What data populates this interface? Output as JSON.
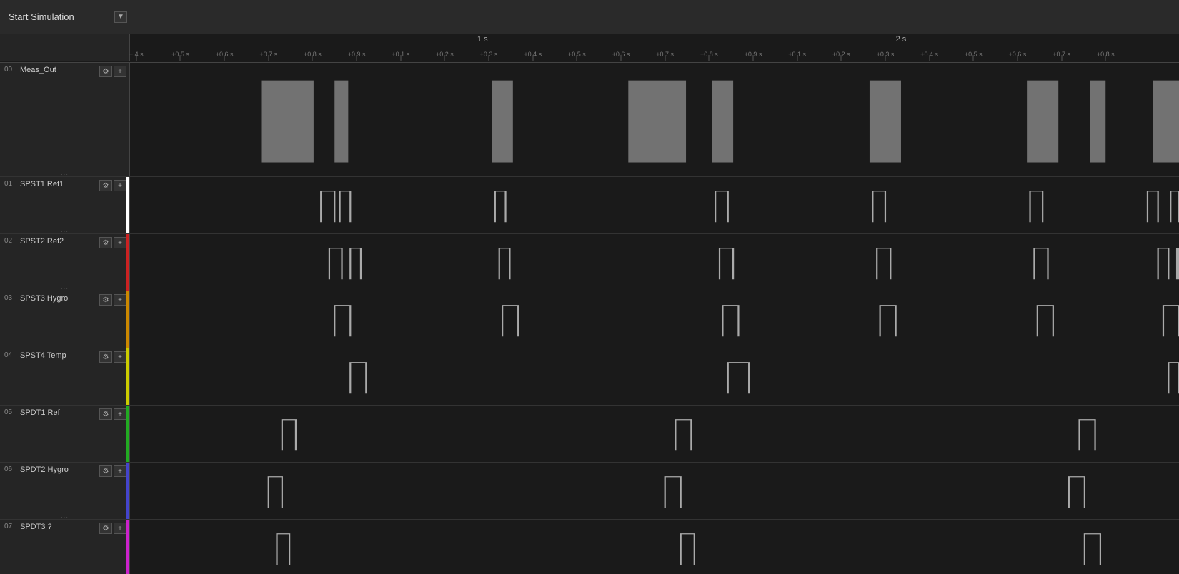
{
  "header": {
    "start_simulation_label": "Start Simulation",
    "arrow_label": "▼"
  },
  "ruler": {
    "major_labels": [
      {
        "label": "1 s",
        "pos_pct": 33.6
      },
      {
        "label": "2 s",
        "pos_pct": 73.5
      }
    ],
    "minor_labels": [
      {
        "label": "+.4 s",
        "pos_pct": 0.6
      },
      {
        "label": "+0.5 s",
        "pos_pct": 4.8
      },
      {
        "label": "+0.6 s",
        "pos_pct": 9.0
      },
      {
        "label": "+0.7 s",
        "pos_pct": 13.2
      },
      {
        "label": "+0.8 s",
        "pos_pct": 17.4
      },
      {
        "label": "+0.9 s",
        "pos_pct": 21.6
      },
      {
        "label": "+0.1 s",
        "pos_pct": 25.8
      },
      {
        "label": "+0.2 s",
        "pos_pct": 30.0
      },
      {
        "label": "+0.3 s",
        "pos_pct": 34.2
      },
      {
        "label": "+0.4 s",
        "pos_pct": 38.4
      },
      {
        "label": "+0.5 s",
        "pos_pct": 42.6
      },
      {
        "label": "+0.6 s",
        "pos_pct": 46.8
      },
      {
        "label": "+0.7 s",
        "pos_pct": 51.0
      },
      {
        "label": "+0.8 s",
        "pos_pct": 55.2
      },
      {
        "label": "+0.9 s",
        "pos_pct": 59.4
      },
      {
        "label": "+0.1 s",
        "pos_pct": 63.6
      },
      {
        "label": "+0.2 s",
        "pos_pct": 67.8
      },
      {
        "label": "+0.3 s",
        "pos_pct": 72.0
      },
      {
        "label": "+0.4 s",
        "pos_pct": 76.2
      },
      {
        "label": "+0.5 s",
        "pos_pct": 80.4
      },
      {
        "label": "+0.6 s",
        "pos_pct": 84.6
      },
      {
        "label": "+0.7 s",
        "pos_pct": 88.8
      },
      {
        "label": "+0.8 s",
        "pos_pct": 93.0
      }
    ]
  },
  "channels": [
    {
      "id": "00",
      "name": "Meas_Out",
      "color": "transparent",
      "row_class": "row-0",
      "waveform_type": "analog_gray",
      "pulses": [
        {
          "start": 12.5,
          "end": 17.5,
          "height": 0.85
        },
        {
          "start": 19.5,
          "end": 20.8,
          "height": 0.85
        },
        {
          "start": 34.5,
          "end": 36.5,
          "height": 0.85
        },
        {
          "start": 47.5,
          "end": 53.0,
          "height": 0.85
        },
        {
          "start": 55.5,
          "end": 57.5,
          "height": 0.85
        },
        {
          "start": 70.5,
          "end": 73.5,
          "height": 0.85
        },
        {
          "start": 85.5,
          "end": 88.5,
          "height": 0.85
        },
        {
          "start": 91.5,
          "end": 93.0,
          "height": 0.85
        },
        {
          "start": 97.5,
          "end": 100.0,
          "height": 0.85
        }
      ]
    },
    {
      "id": "01",
      "name": "SPST1 Ref1",
      "color": "#ffffff",
      "row_class": "row-1",
      "waveform_type": "digital",
      "pulses": [
        {
          "start": 18.2,
          "end": 19.5
        },
        {
          "start": 20.0,
          "end": 21.0
        },
        {
          "start": 34.8,
          "end": 35.8
        },
        {
          "start": 55.8,
          "end": 57.0
        },
        {
          "start": 70.8,
          "end": 72.0
        },
        {
          "start": 85.8,
          "end": 87.0
        },
        {
          "start": 97.0,
          "end": 98.0
        },
        {
          "start": 99.2,
          "end": 100.0
        }
      ]
    },
    {
      "id": "02",
      "name": "SPST2 Ref2",
      "color": "#cc2222",
      "row_class": "row-2",
      "waveform_type": "digital",
      "pulses": [
        {
          "start": 19.0,
          "end": 20.2
        },
        {
          "start": 21.0,
          "end": 22.0
        },
        {
          "start": 35.2,
          "end": 36.2
        },
        {
          "start": 56.2,
          "end": 57.5
        },
        {
          "start": 71.2,
          "end": 72.5
        },
        {
          "start": 86.2,
          "end": 87.5
        },
        {
          "start": 98.0,
          "end": 99.0
        },
        {
          "start": 99.8,
          "end": 100.0
        }
      ]
    },
    {
      "id": "03",
      "name": "SPST3 Hygro",
      "color": "#cc8800",
      "row_class": "row-3",
      "waveform_type": "digital",
      "pulses": [
        {
          "start": 19.5,
          "end": 21.0
        },
        {
          "start": 35.5,
          "end": 37.0
        },
        {
          "start": 56.5,
          "end": 58.0
        },
        {
          "start": 71.5,
          "end": 73.0
        },
        {
          "start": 86.5,
          "end": 88.0
        },
        {
          "start": 98.5,
          "end": 100.0
        }
      ]
    },
    {
      "id": "04",
      "name": "SPST4 Temp",
      "color": "#cccc00",
      "row_class": "row-4",
      "waveform_type": "digital",
      "pulses": [
        {
          "start": 21.0,
          "end": 22.5
        },
        {
          "start": 57.0,
          "end": 59.0
        },
        {
          "start": 99.0,
          "end": 100.0
        }
      ]
    },
    {
      "id": "05",
      "name": "SPDT1 Ref",
      "color": "#22aa22",
      "row_class": "row-5",
      "waveform_type": "digital",
      "pulses": [
        {
          "start": 14.5,
          "end": 15.8
        },
        {
          "start": 52.0,
          "end": 53.5
        },
        {
          "start": 90.5,
          "end": 92.0
        }
      ]
    },
    {
      "id": "06",
      "name": "SPDT2 Hygro",
      "color": "#4444cc",
      "row_class": "row-6",
      "waveform_type": "digital",
      "pulses": [
        {
          "start": 13.2,
          "end": 14.5
        },
        {
          "start": 51.0,
          "end": 52.5
        },
        {
          "start": 89.5,
          "end": 91.0
        }
      ]
    },
    {
      "id": "07",
      "name": "SPDT3 ?",
      "color": "#cc22cc",
      "row_class": "row-7",
      "waveform_type": "digital",
      "pulses": [
        {
          "start": 14.0,
          "end": 15.2
        },
        {
          "start": 52.5,
          "end": 53.8
        },
        {
          "start": 91.0,
          "end": 92.5
        }
      ]
    }
  ],
  "icons": {
    "gear": "⚙",
    "plus": "+",
    "resize": "···"
  }
}
